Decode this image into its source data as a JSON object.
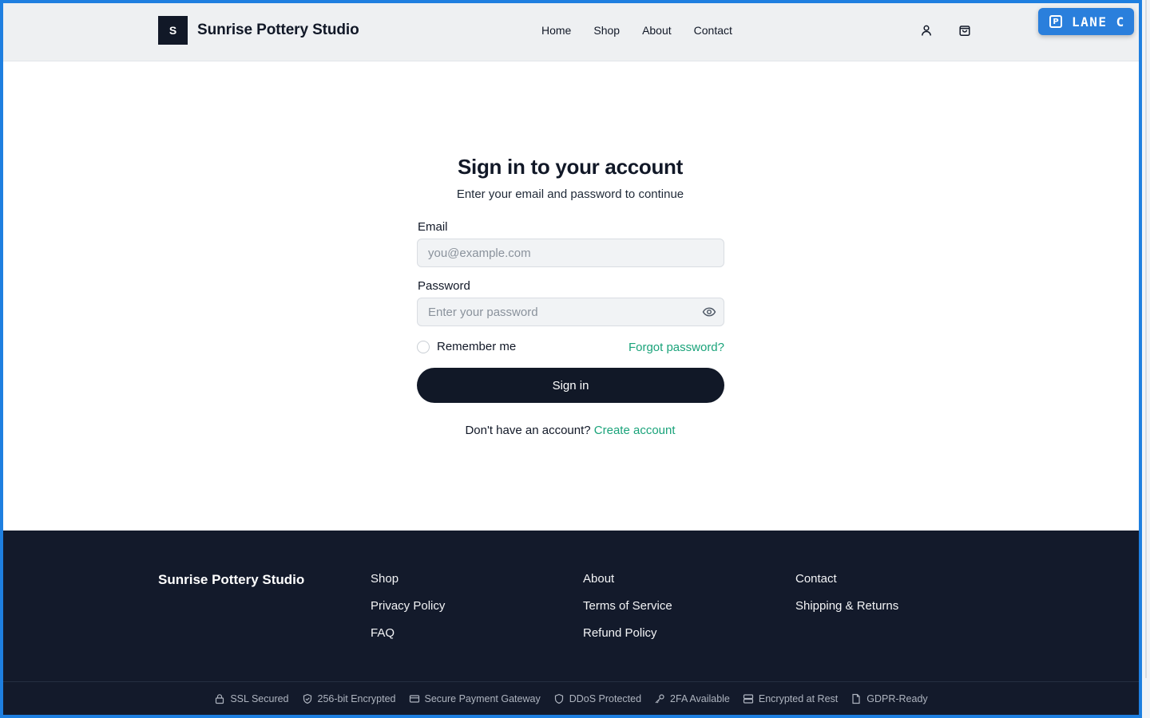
{
  "header": {
    "logo_letter": "S",
    "brand": "Sunrise Pottery Studio",
    "nav": [
      "Home",
      "Shop",
      "About",
      "Contact"
    ],
    "icons": [
      "user-icon",
      "shopping-bag-icon"
    ]
  },
  "badge_overlay": {
    "icon": "parking-icon",
    "label": "LANE C"
  },
  "form": {
    "title": "Sign in to your account",
    "subtitle": "Enter your email and password to continue",
    "email_label": "Email",
    "email_placeholder": "you@example.com",
    "email_value": "",
    "password_label": "Password",
    "password_placeholder": "Enter your password",
    "password_value": "",
    "remember_label": "Remember me",
    "remember_checked": false,
    "forgot_label": "Forgot password?",
    "submit_label": "Sign in",
    "no_account_text": "Don't have an account?",
    "create_account_label": "Create account"
  },
  "footer": {
    "brand": "Sunrise Pottery Studio",
    "columns": [
      [
        "Shop",
        "Privacy Policy",
        "FAQ"
      ],
      [
        "About",
        "Terms of Service",
        "Refund Policy"
      ],
      [
        "Contact",
        "Shipping & Returns"
      ]
    ],
    "trust_badges": [
      {
        "icon": "lock-icon",
        "label": "SSL Secured"
      },
      {
        "icon": "shield-check-icon",
        "label": "256-bit Encrypted"
      },
      {
        "icon": "credit-card-icon",
        "label": "Secure Payment Gateway"
      },
      {
        "icon": "shield-icon",
        "label": "DDoS Protected"
      },
      {
        "icon": "key-icon",
        "label": "2FA Available"
      },
      {
        "icon": "server-icon",
        "label": "Encrypted at Rest"
      },
      {
        "icon": "document-icon",
        "label": "GDPR-Ready"
      }
    ]
  },
  "colors": {
    "primary": "#111827",
    "accent": "#1aa37a",
    "header_bg": "#eef0f2",
    "footer_bg": "#131a2b",
    "frame": "#1e7fe0"
  }
}
